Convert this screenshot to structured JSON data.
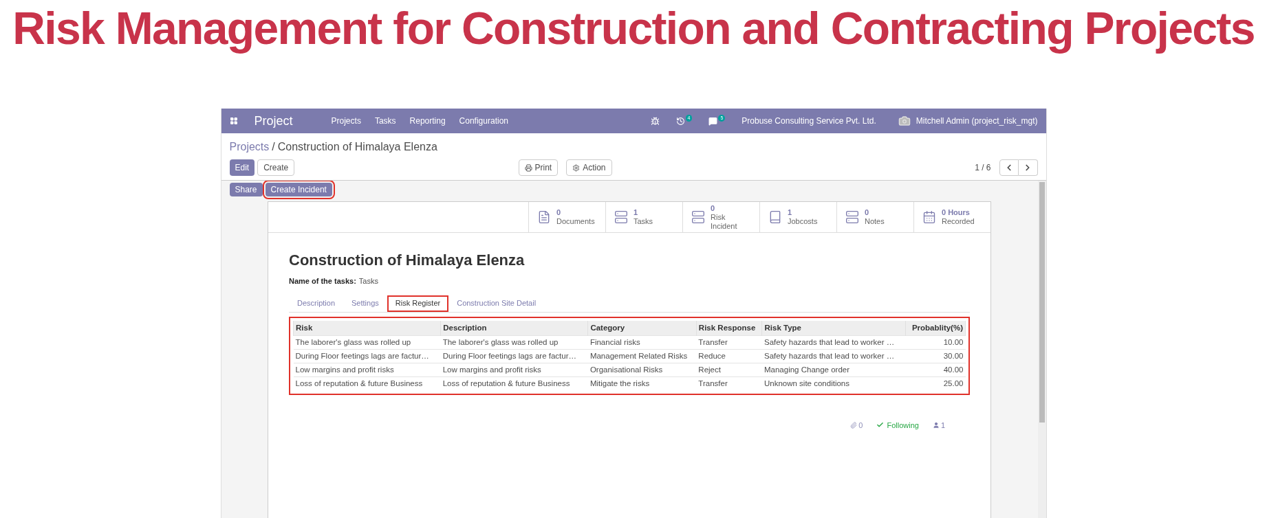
{
  "title": "Risk Management for Construction and Contracting Projects",
  "navbar": {
    "app": "Project",
    "menu": [
      "Projects",
      "Tasks",
      "Reporting",
      "Configuration"
    ],
    "activity_badge": "4",
    "message_badge": "5",
    "company": "Probuse Consulting Service Pvt. Ltd.",
    "user": "Mitchell Admin (project_risk_mgt)"
  },
  "breadcrumb": {
    "parent": "Projects",
    "separator": "/",
    "current": "Construction of Himalaya Elenza"
  },
  "buttons": [
    {
      "label": "Edit",
      "kind": "primary"
    },
    {
      "label": "Create",
      "kind": "secondary"
    }
  ],
  "print": "Print",
  "action": "Action",
  "pager": "1 / 6",
  "action_buttons": [
    {
      "label": "Share",
      "highlighted": false
    },
    {
      "label": "Create Incident",
      "highlighted": true
    }
  ],
  "stat_buttons": [
    {
      "value": "0",
      "label": "Documents",
      "kind": "document"
    },
    {
      "value": "1",
      "label": "Tasks",
      "kind": "list"
    },
    {
      "value": "0",
      "label": "Risk Incident",
      "kind": "list"
    },
    {
      "value": "1",
      "label": "Jobcosts",
      "kind": "book"
    },
    {
      "value": "0",
      "label": "Notes",
      "kind": "list"
    },
    {
      "value": "0 Hours",
      "label": "Recorded",
      "kind": "calendar"
    }
  ],
  "record_title": "Construction of Himalaya Elenza",
  "field": {
    "label": "Name of the tasks:",
    "value": "Tasks"
  },
  "tabs": [
    {
      "label": "Description",
      "selected": false,
      "highlighted": false
    },
    {
      "label": "Settings",
      "selected": false,
      "highlighted": false
    },
    {
      "label": "Risk Register",
      "selected": true,
      "highlighted": true
    },
    {
      "label": "Construction Site Detail",
      "selected": false,
      "highlighted": false
    }
  ],
  "table": {
    "highlighted": true,
    "columns": [
      "Risk",
      "Description",
      "Category",
      "Risk Response",
      "Risk Type",
      "Probablity(%)"
    ],
    "rows": [
      [
        "The laborer's glass was rolled up",
        "The laborer's glass was rolled up",
        "Financial risks",
        "Transfer",
        "Safety hazards that lead to worker …",
        "10.00"
      ],
      [
        "During Floor feetings lags are factur…",
        "During Floor feetings lags are factur…",
        "Management Related Risks",
        "Reduce",
        "Safety hazards that lead to worker …",
        "30.00"
      ],
      [
        "Low margins and profit risks",
        "Low margins and profit risks",
        "Organisational Risks",
        "Reject",
        "Managing Change order",
        "40.00"
      ],
      [
        "Loss of reputation & future Business",
        "Loss of reputation & future Business",
        "Mitigate the risks",
        "Transfer",
        "Unknown site conditions",
        "25.00"
      ]
    ]
  },
  "chatter": {
    "attachments": "0",
    "follow": "Following",
    "followers": "1"
  }
}
